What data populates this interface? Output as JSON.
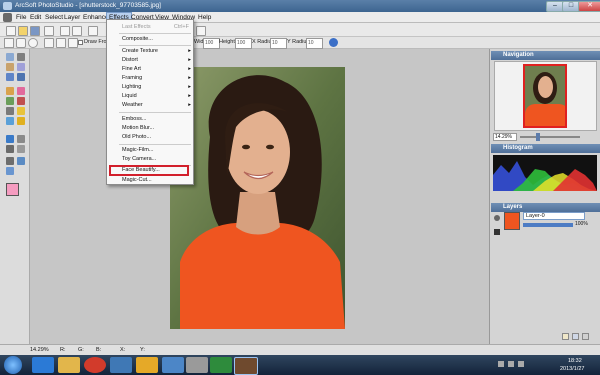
{
  "window": {
    "title": "ArcSoft PhotoStudio - [shutterstock_97703585.jpg]",
    "controls": {
      "minimize": "–",
      "maximize": "□",
      "close": "✕"
    }
  },
  "menubar": {
    "items": [
      "File",
      "Edit",
      "Select",
      "Layer",
      "Enhance",
      "Effects",
      "Convert",
      "View",
      "Window",
      "Help"
    ],
    "active": "Effects"
  },
  "toolbar2": {
    "draw_from_center_label": "Draw From C",
    "width_label": "Width:",
    "width_value": "100",
    "height_label": "Height:",
    "height_value": "100",
    "x_radius_label": "X Radius:",
    "x_radius_value": "10",
    "y_radius_label": "Y Radius:",
    "y_radius_value": "10"
  },
  "effects_menu": {
    "items": [
      {
        "label": "Last Effects",
        "shortcut": "Ctrl+F",
        "disabled": true,
        "submenu": false
      },
      {
        "label": "Composite...",
        "submenu": false
      },
      {
        "label": "Create Texture",
        "submenu": true
      },
      {
        "label": "Distort",
        "submenu": true
      },
      {
        "label": "Fine Art",
        "submenu": true
      },
      {
        "label": "Framing",
        "submenu": true
      },
      {
        "label": "Lighting",
        "submenu": true
      },
      {
        "label": "Liquid",
        "submenu": true
      },
      {
        "label": "Weather",
        "submenu": true
      },
      {
        "label": "Emboss...",
        "submenu": false
      },
      {
        "label": "Motion Blur...",
        "submenu": false
      },
      {
        "label": "Old Photo...",
        "submenu": false
      },
      {
        "label": "Magic-Film...",
        "submenu": false
      },
      {
        "label": "Toy Camera...",
        "submenu": false
      },
      {
        "label": "Face Beautify...",
        "submenu": false,
        "highlighted": true
      },
      {
        "label": "Magic-Cut...",
        "submenu": false
      }
    ],
    "highlight_color": "#d21f2b"
  },
  "navigator": {
    "title": "Navigation",
    "zoom": "14.29%"
  },
  "histogram": {
    "title": "Histogram"
  },
  "layers": {
    "title": "Layers",
    "layer_name": "Layer-0",
    "opacity": "100%"
  },
  "statusbar": {
    "zoom": "14.29%",
    "r_label": "R:",
    "g_label": "G:",
    "b_label": "B:",
    "x_label": "X:",
    "y_label": "Y:"
  },
  "taskbar": {
    "time": "18:32",
    "date": "2013/1/27"
  },
  "colors": {
    "foreground": "#f59cc0",
    "background": "#ffffff",
    "titlebar": "#3d6590",
    "panel_header": "#4f6f98"
  }
}
